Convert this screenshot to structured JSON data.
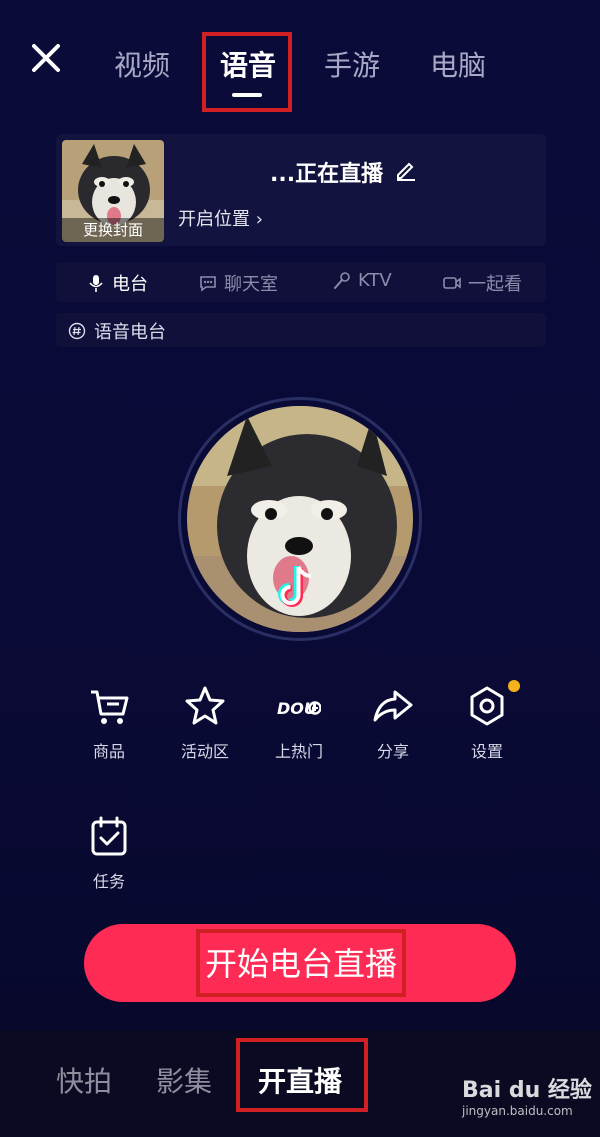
{
  "top_tabs": [
    "视频",
    "语音",
    "手游",
    "电脑"
  ],
  "active_tab": "语音",
  "cover": {
    "change_label": "更换封面"
  },
  "live_title": "...正在直播",
  "location": "开启位置 ›",
  "modes": [
    "电台",
    "聊天室",
    "KTV",
    "一起看"
  ],
  "topic": "语音电台",
  "tools": [
    {
      "label": "商品",
      "icon": "cart-icon"
    },
    {
      "label": "活动区",
      "icon": "star-icon"
    },
    {
      "label": "上热门",
      "icon": "dou-icon",
      "icon_text": "DOU"
    },
    {
      "label": "分享",
      "icon": "share-icon"
    },
    {
      "label": "设置",
      "icon": "settings-icon"
    },
    {
      "label": "任务",
      "icon": "task-icon"
    }
  ],
  "start_button": "开始电台直播",
  "bottom_nav": [
    "快拍",
    "影集",
    "开直播"
  ],
  "watermark": {
    "main": "Bai du 经验",
    "sub": "jingyan.baidu.com"
  },
  "colors": {
    "accent": "#fe2c55",
    "highlight_box": "#d12024",
    "notification_dot": "#f5b21b"
  }
}
